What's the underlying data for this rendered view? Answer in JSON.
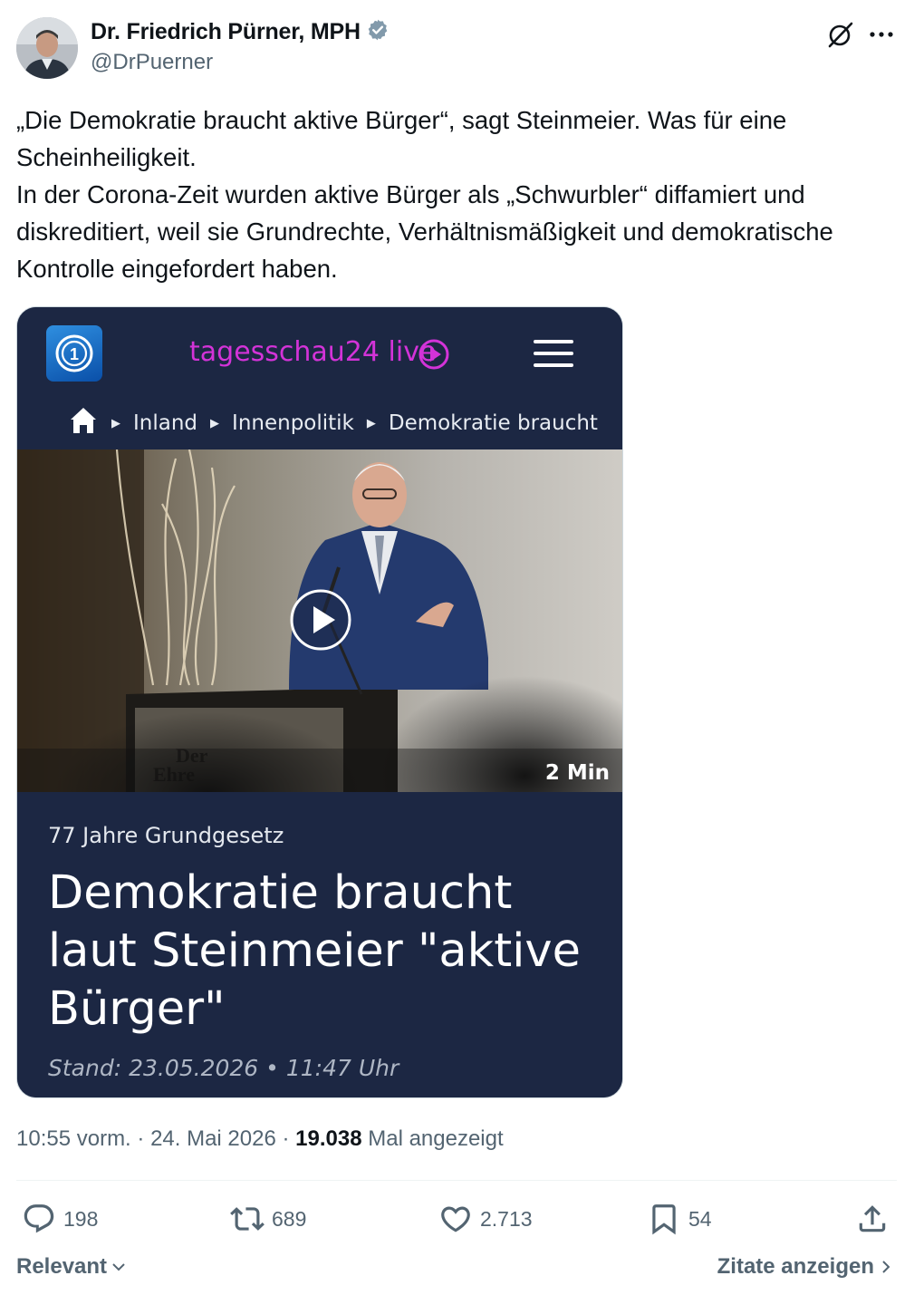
{
  "author": {
    "name": "Dr. Friedrich Pürner, MPH",
    "handle": "@DrPuerner",
    "verified": true,
    "avatar_icon": "profile-photo"
  },
  "tweet": {
    "lines": [
      "„Die Demokratie braucht aktive Bürger“, sagt Steinmeier. Was für eine Scheinheiligkeit.",
      "In der Corona-Zeit wurden aktive Bürger als „Schwurbler“ diffamiert und diskreditiert, weil sie Grundrechte, Verhältnismäßigkeit und demokratische Kontrolle eingefordert haben."
    ]
  },
  "media": {
    "site_title": "tagesschau24 live",
    "breadcrumbs": [
      "Inland",
      "Innenpolitik",
      "Demokratie braucht"
    ],
    "duration": "2 Min",
    "lectern_text": [
      "Der",
      "Ehre"
    ],
    "topline": "77 Jahre Grundgesetz",
    "headline": "Demokratie braucht laut Steinmeier \"aktive Bürger\"",
    "stand": "Stand: 23.05.2026 • 11:47 Uhr",
    "accent_color": "#d333d8",
    "background_color": "#1c2743"
  },
  "meta": {
    "time": "10:55 vorm.",
    "sep1": " · ",
    "date": "24. Mai 2026",
    "sep2": " · ",
    "views": "19.038",
    "views_label": " Mal angezeigt"
  },
  "actions": {
    "replies": "198",
    "reposts": "689",
    "likes": "2.713",
    "bookmarks": "54"
  },
  "footer": {
    "sort_label": "Relevant",
    "quotes_label": "Zitate anzeigen"
  }
}
